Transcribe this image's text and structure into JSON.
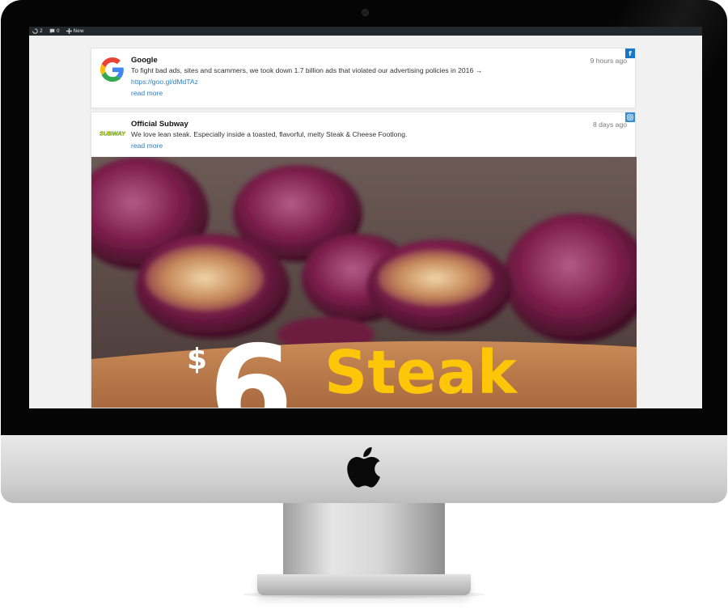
{
  "adminbar": {
    "updates_count": "2",
    "comments_count": "0",
    "new_label": "New"
  },
  "feed": {
    "posts": [
      {
        "author": "Google",
        "network": "facebook",
        "time": "9 hours ago",
        "text": "To fight bad ads, sites and scammers, we took down 1.7 billion ads that violated our advertising policies in 2016 →",
        "link": "https://goo.gl/dMdTAz",
        "read_more": "read more"
      },
      {
        "author": "Official Subway",
        "network": "instagram",
        "time": "8 days ago",
        "text": "We love lean steak. Especially inside a toasted, flavorful, melty Steak & Cheese Footlong.",
        "read_more": "read more",
        "avatar_logo_text": "SUBWAY",
        "image": {
          "price_symbol": "$",
          "price_digit": "6",
          "headline": "Steak"
        }
      }
    ]
  },
  "colors": {
    "link": "#2a7fc8",
    "facebook": "#1877c6",
    "instagram": "#3a8ed0",
    "subway_yellow": "#fdc608",
    "subway_green": "#008c15"
  }
}
